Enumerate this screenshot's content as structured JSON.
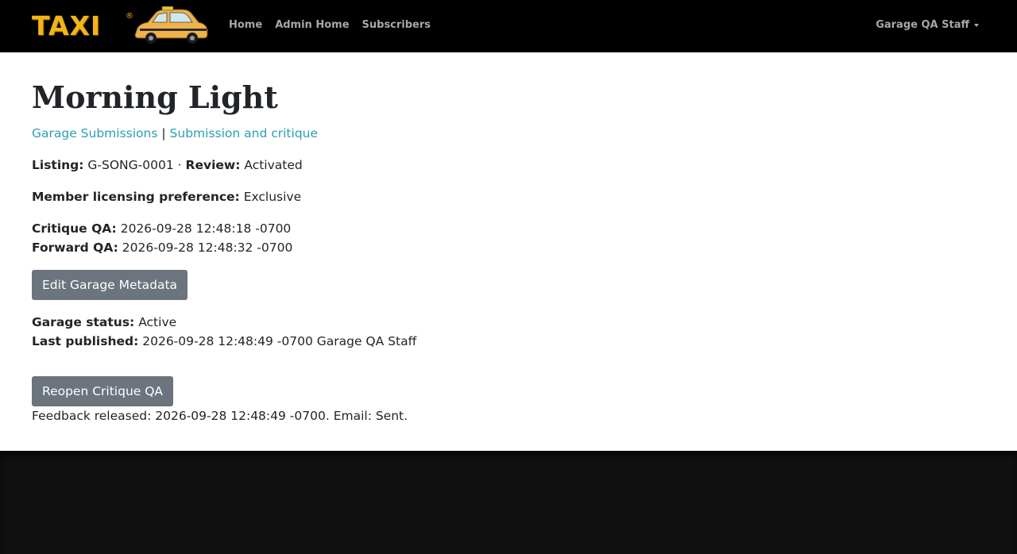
{
  "navbar": {
    "brand": "TAXI",
    "brand_mark": "®",
    "links": [
      "Home",
      "Admin Home",
      "Subscribers"
    ],
    "user": "Garage QA Staff"
  },
  "page": {
    "title": "Morning Light",
    "breadcrumb": {
      "first": "Garage Submissions",
      "sep": "|",
      "second": "Submission and critique"
    },
    "listing_label": "Listing:",
    "listing_value": "G-SONG-0001",
    "dot": "·",
    "review_label": "Review:",
    "review_value": "Activated",
    "licensing_label": "Member licensing preference:",
    "licensing_value": "Exclusive",
    "critique_label": "Critique QA:",
    "critique_value": "2026-09-28 12:48:18 -0700",
    "forward_label": "Forward QA:",
    "forward_value": "2026-09-28 12:48:32 -0700",
    "edit_button": "Edit Garage Metadata",
    "garage_status_label": "Garage status:",
    "garage_status_value": "Active",
    "last_published_label": "Last published:",
    "last_published_value": "2026-09-28 12:48:49 -0700 Garage QA Staff",
    "reopen_button": "Reopen Critique QA",
    "feedback_text": "Feedback released: 2026-09-28 12:48:49 -0700. Email: Sent."
  },
  "colors": {
    "navbar_bg": "#000000",
    "brand_yellow": "#f3b418",
    "link": "#2a9fb4",
    "button_bg": "#6c757d",
    "footer_bg": "#111111"
  }
}
